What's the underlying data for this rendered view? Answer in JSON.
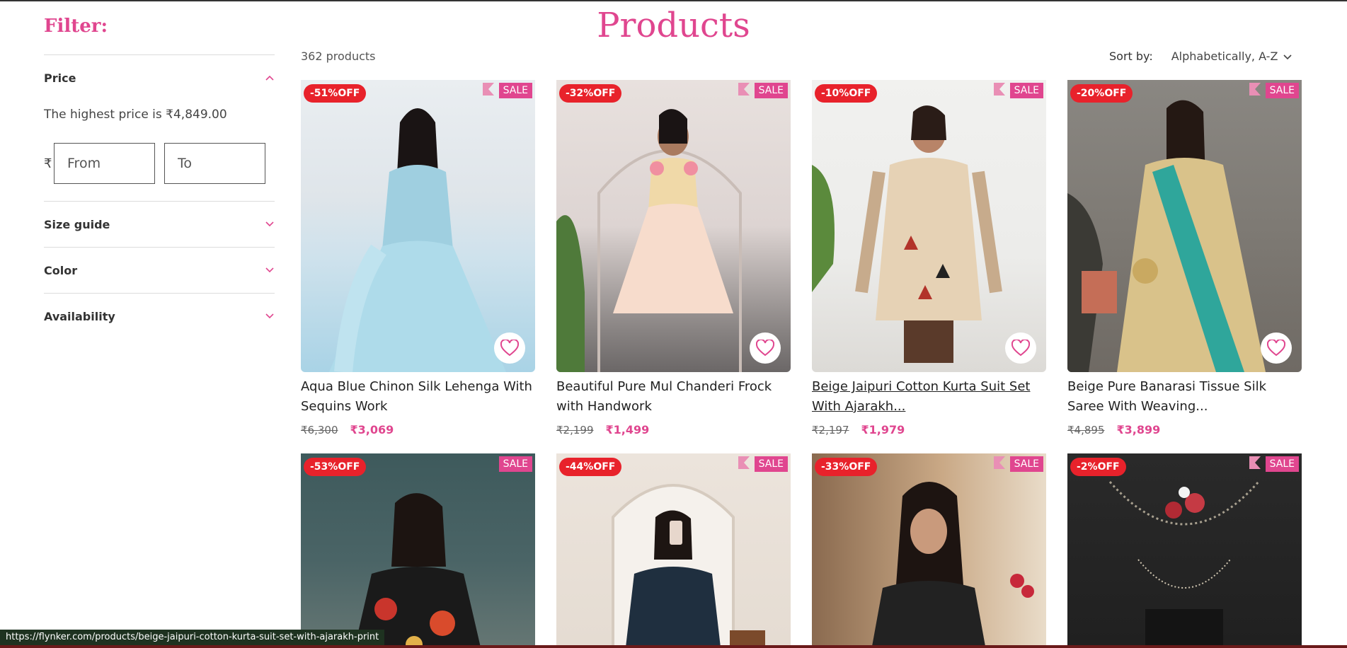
{
  "filter": {
    "title": "Filter:",
    "price_label": "Price",
    "price_note": "The highest price is ₹4,849.00",
    "currency": "₹",
    "from_placeholder": "From",
    "to_placeholder": "To",
    "facets": [
      "Size guide",
      "Color",
      "Availability"
    ]
  },
  "header": {
    "title": "Products",
    "count": "362 products",
    "sort_label": "Sort by:",
    "sort_value": "Alphabetically, A-Z"
  },
  "colors": {
    "accent": "#e0468f",
    "discount": "#e8222b"
  },
  "products": [
    {
      "discount": "-51%OFF",
      "sale": "SALE",
      "name": "Aqua Blue Chinon Silk Lehenga With Sequins Work",
      "old_price": "₹6,300",
      "price": "₹3,069"
    },
    {
      "discount": "-32%OFF",
      "sale": "SALE",
      "name": "Beautiful Pure Mul Chanderi Frock with Handwork",
      "old_price": "₹2,199",
      "price": "₹1,499"
    },
    {
      "discount": "-10%OFF",
      "sale": "SALE",
      "name": "Beige Jaipuri Cotton Kurta Suit Set With Ajarakh...",
      "old_price": "₹2,197",
      "price": "₹1,979"
    },
    {
      "discount": "-20%OFF",
      "sale": "SALE",
      "name": "Beige Pure Banarasi Tissue Silk Saree With Weaving...",
      "old_price": "₹4,895",
      "price": "₹3,899"
    },
    {
      "discount": "-53%OFF",
      "sale": "SALE"
    },
    {
      "discount": "-44%OFF",
      "sale": "SALE"
    },
    {
      "discount": "-33%OFF",
      "sale": "SALE"
    },
    {
      "discount": "-2%OFF",
      "sale": "SALE"
    }
  ],
  "status_url": "https://flynker.com/products/beige-jaipuri-cotton-kurta-suit-set-with-ajarakh-print"
}
